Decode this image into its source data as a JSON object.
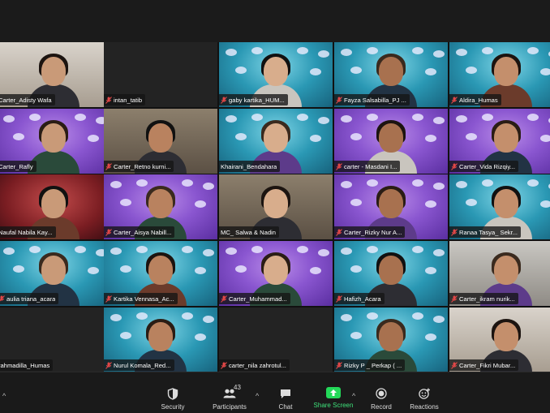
{
  "participants": [
    {
      "name": "Carter_Adisty Wafa",
      "theme": "pale",
      "muted": false,
      "col": 0,
      "row": 0
    },
    {
      "name": "intan_tatib",
      "theme": "dark",
      "muted": true,
      "col": 1,
      "row": 0
    },
    {
      "name": "gaby kartika_HUM...",
      "theme": "teal",
      "muted": true,
      "col": 2,
      "row": 0
    },
    {
      "name": "Fayza Salsabilla_PJ ...",
      "theme": "teal",
      "muted": true,
      "col": 3,
      "row": 0
    },
    {
      "name": "Aldira_Humas",
      "theme": "teal",
      "muted": true,
      "col": 4,
      "row": 0
    },
    {
      "name": "Carter_Rafly",
      "theme": "purple",
      "muted": false,
      "col": 0,
      "row": 1
    },
    {
      "name": "Carter_Retno kurni...",
      "theme": "room",
      "muted": true,
      "col": 1,
      "row": 1
    },
    {
      "name": "Khairani_Bendahara",
      "theme": "teal",
      "muted": false,
      "col": 2,
      "row": 1
    },
    {
      "name": "carter - Masdani I...",
      "theme": "purple",
      "muted": true,
      "col": 3,
      "row": 1
    },
    {
      "name": "Carter_Vida Rizqiy...",
      "theme": "purple",
      "muted": true,
      "col": 4,
      "row": 1
    },
    {
      "name": "Naufal Nabila Kay...",
      "theme": "red",
      "muted": false,
      "col": 0,
      "row": 2
    },
    {
      "name": "Carter_Aisya Nabill...",
      "theme": "purple",
      "muted": true,
      "col": 1,
      "row": 2
    },
    {
      "name": "MC_ Salwa & Nadin",
      "theme": "room",
      "muted": false,
      "col": 2,
      "row": 2,
      "speaker": true
    },
    {
      "name": "Carter_Rizky Nur A...",
      "theme": "purple",
      "muted": true,
      "col": 3,
      "row": 2
    },
    {
      "name": "Ranaa Tasya_ Sekr...",
      "theme": "teal",
      "muted": true,
      "col": 4,
      "row": 2
    },
    {
      "name": "aulia triana_acara",
      "theme": "teal",
      "muted": true,
      "col": 0,
      "row": 3
    },
    {
      "name": "Kartika Vennasa_Ac...",
      "theme": "teal",
      "muted": true,
      "col": 1,
      "row": 3
    },
    {
      "name": "Carter_Muhammad...",
      "theme": "purple",
      "muted": true,
      "col": 2,
      "row": 3
    },
    {
      "name": "Hafizh_Acara",
      "theme": "teal",
      "muted": true,
      "col": 3,
      "row": 3
    },
    {
      "name": "Carter_ikram nurik...",
      "theme": "greyroom",
      "muted": true,
      "col": 4,
      "row": 3
    },
    {
      "name": "rahmadilla_Humas",
      "theme": "dark",
      "muted": false,
      "col": 0,
      "row": 4
    },
    {
      "name": "Nurul Komala_Red...",
      "theme": "teal",
      "muted": true,
      "col": 1,
      "row": 4
    },
    {
      "name": "carter_nila zahrotul...",
      "theme": "dark",
      "muted": true,
      "col": 2,
      "row": 4
    },
    {
      "name": "Rizky P _ Perkap ( ...",
      "theme": "teal",
      "muted": true,
      "col": 3,
      "row": 4
    },
    {
      "name": "Carter_Fikri Mubar...",
      "theme": "pale",
      "muted": true,
      "col": 4,
      "row": 4
    }
  ],
  "toolbar": {
    "security": "Security",
    "participants": "Participants",
    "participants_count": "43",
    "chat": "Chat",
    "share_screen": "Share Screen",
    "record": "Record",
    "reactions": "Reactions"
  },
  "colors": {
    "speaker_outline": "#e7e23a",
    "muted_mic": "#e14747",
    "share_green": "#23d959"
  }
}
